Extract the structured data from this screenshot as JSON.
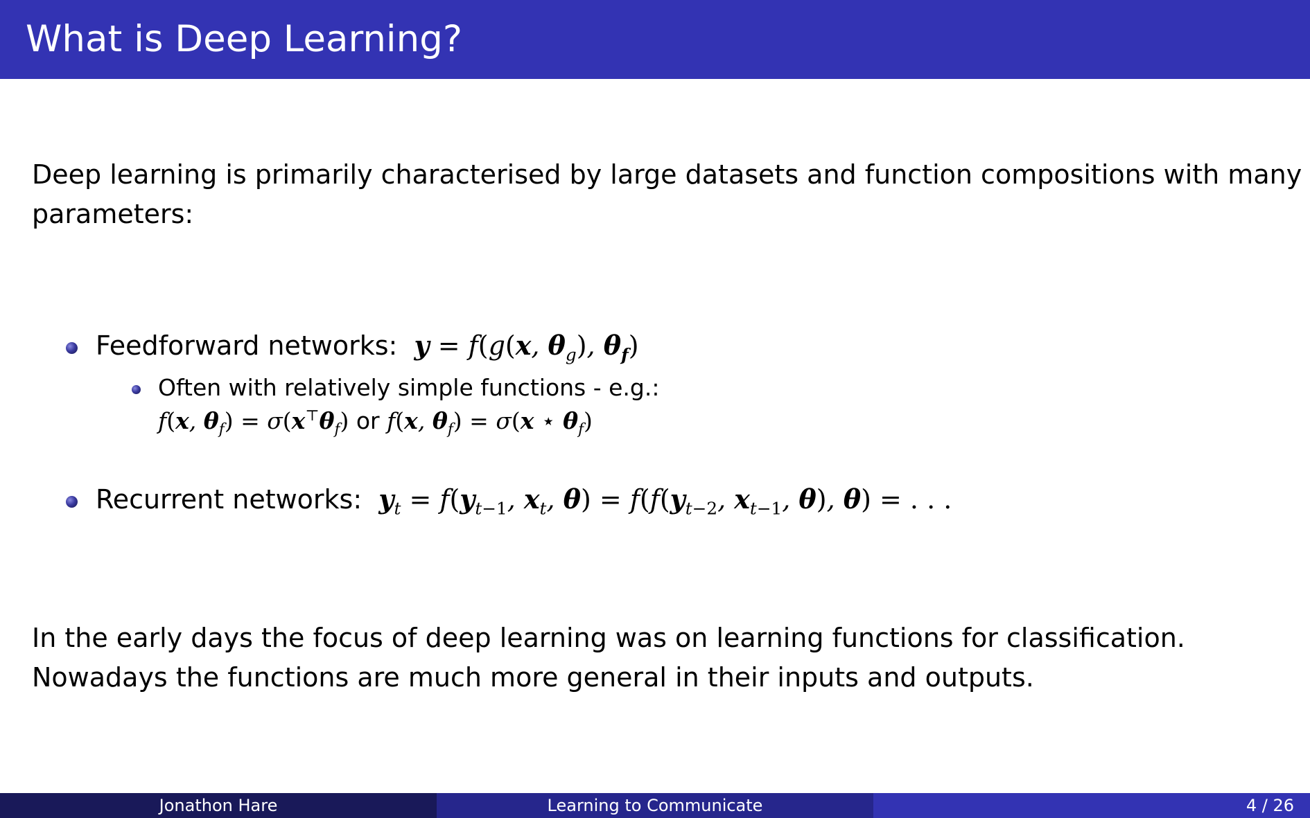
{
  "slide": {
    "title": "What is Deep Learning?",
    "intro_line1": "Deep learning is primarily characterised by large datasets and function compositions with many",
    "intro_line2": "parameters:",
    "bullets": [
      {
        "label": "Feedforward networks:",
        "equation": "y = f(g(x, θg), θf)",
        "sub": {
          "label": "Often with relatively simple functions - e.g.:",
          "equation": "f(x, θf) = σ(x⊤θf) or f(x, θf) = σ(x ⋆ θf)"
        }
      },
      {
        "label": "Recurrent networks:",
        "equation": "yt = f(yt−1, xt, θ) = f(f(yt−2, xt−1, θ), θ) = . . ."
      }
    ],
    "outro_line1": "In the early days the focus of deep learning was on learning functions for classification.",
    "outro_line2": "Nowadays the functions are much more general in their inputs and outputs."
  },
  "footer": {
    "author": "Jonathon Hare",
    "talk_title": "Learning to Communicate",
    "page": "4 / 26"
  },
  "colors": {
    "header": "#3333b3",
    "footer_left": "#191959",
    "footer_mid": "#26268c",
    "footer_right": "#3333b3"
  }
}
